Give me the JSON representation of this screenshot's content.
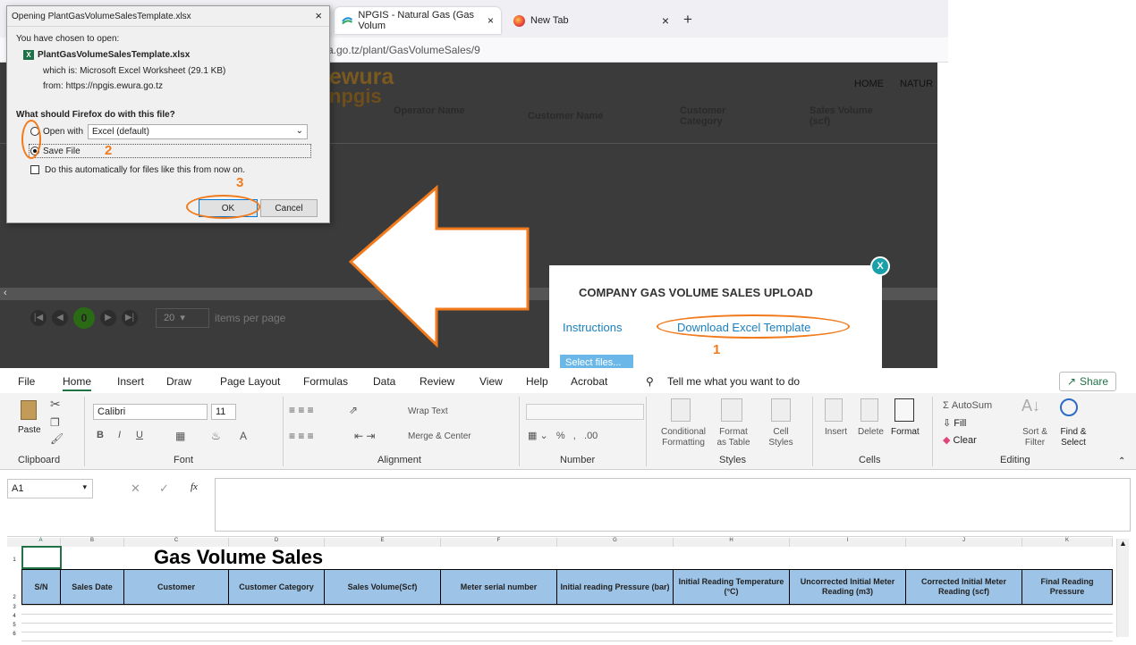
{
  "browser": {
    "tabs": [
      {
        "label": "NPGIS - Natural Gas (Gas Volum",
        "active": true
      },
      {
        "label": "New Tab",
        "active": false
      }
    ],
    "url_visible": "a.go.tz/plant/GasVolumeSales/9",
    "new_tab": "+",
    "close": "×"
  },
  "background_page": {
    "logo_top": "ewura",
    "logo_bottom": "npgis",
    "nav": [
      "HOME",
      "NATUR"
    ],
    "columns": [
      "Operator Name",
      "Customer Name",
      "Customer Category",
      "Sales Volume (scf)"
    ],
    "pager": {
      "current": "0",
      "page_size": "20",
      "items_label": "items per page"
    }
  },
  "dialog": {
    "title": "Opening PlantGasVolumeSalesTemplate.xlsx",
    "intro": "You have chosen to open:",
    "filename": "PlantGasVolumeSalesTemplate.xlsx",
    "which_is_label": "which is:",
    "which_is_value": "Microsoft Excel Worksheet (29.1 KB)",
    "from_label": "from:",
    "from_value": "https://npgis.ewura.go.tz",
    "question": "What should Firefox do with this file?",
    "open_with_label": "Open with",
    "open_with_value": "Excel (default)",
    "save_file_label": "Save File",
    "auto_label": "Do this automatically for files like this from now on.",
    "ok": "OK",
    "cancel": "Cancel",
    "selected_option": "save_file"
  },
  "annotations": {
    "one": "1",
    "two": "2",
    "three": "3"
  },
  "upload_modal": {
    "title": "COMPANY GAS VOLUME SALES UPLOAD",
    "instructions": "Instructions",
    "download": "Download Excel Template",
    "select_files": "Select files...",
    "close": "X"
  },
  "excel": {
    "menu": [
      "File",
      "Home",
      "Insert",
      "Draw",
      "Page Layout",
      "Formulas",
      "Data",
      "Review",
      "View",
      "Help",
      "Acrobat"
    ],
    "tell_me": "Tell me what you want to do",
    "share": "Share",
    "ribbon": {
      "paste": "Paste",
      "font_name": "Calibri",
      "font_size": "11",
      "wrap_text": "Wrap Text",
      "merge_center": "Merge & Center",
      "conditional": "Conditional Formatting",
      "format_table": "Format as Table",
      "cell_styles": "Cell Styles",
      "insert": "Insert",
      "delete": "Delete",
      "format": "Format",
      "autosum": "AutoSum",
      "fill": "Fill",
      "clear": "Clear",
      "sort": "Sort & Filter",
      "find": "Find & Select",
      "groups": [
        "Clipboard",
        "Font",
        "Alignment",
        "Number",
        "Styles",
        "Cells",
        "Editing"
      ]
    },
    "name_box": "A1",
    "fx": "fx",
    "col_letters": [
      "A",
      "B",
      "C",
      "D",
      "E",
      "F",
      "G",
      "H",
      "I",
      "J",
      "K"
    ],
    "row_numbers": [
      "1",
      "2",
      "3",
      "4",
      "5",
      "6"
    ],
    "sheet_title": "Gas Volume Sales",
    "headers": [
      "S/N",
      "Sales Date",
      "Customer",
      "Customer Category",
      "Sales Volume(Scf)",
      "Meter serial number",
      "Initial reading Pressure (bar)",
      "Initial Reading Temperature (°C)",
      "Uncorrected Initial Meter Reading (m3)",
      "Corrected Initial Meter Reading (scf)",
      "Final Reading Pressure"
    ]
  }
}
